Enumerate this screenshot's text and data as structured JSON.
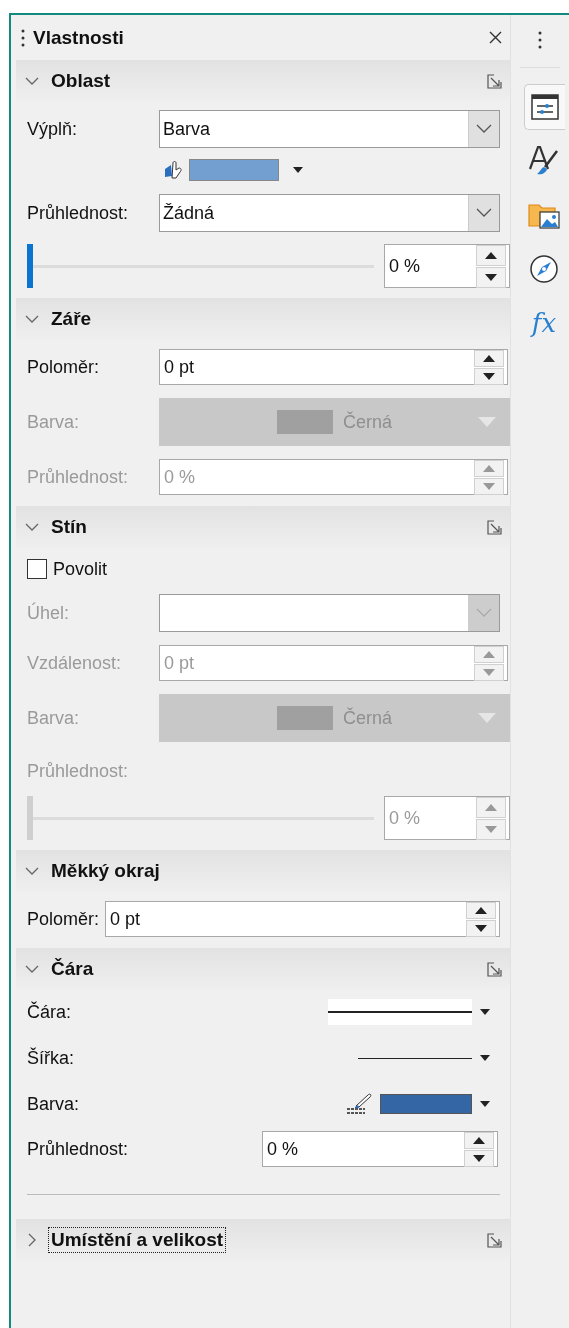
{
  "panel": {
    "title": "Vlastnosti"
  },
  "sections": [
    {
      "title": "Oblast",
      "expanded": true,
      "more_options": true,
      "focused": false,
      "rows": [
        {
          "kind": "dropdown",
          "label": "Výplň:",
          "value": "Barva",
          "disabled": false
        },
        {
          "kind": "color_picker",
          "color": "#729fcf"
        },
        {
          "kind": "dropdown",
          "label": "Průhlednost:",
          "value": "Žádná",
          "disabled": false
        },
        {
          "kind": "slider",
          "level": 0,
          "value": "0 %",
          "disabled": false
        }
      ]
    },
    {
      "title": "Záře",
      "expanded": true,
      "more_options": false,
      "focused": false,
      "rows": [
        {
          "kind": "spin",
          "label": "Poloměr:",
          "value": "0 pt",
          "disabled": false
        },
        {
          "kind": "color_button",
          "label": "Barva:",
          "value": "Černá",
          "disabled": true
        },
        {
          "kind": "spin",
          "label": "Průhlednost:",
          "value": "0 %",
          "disabled": true
        }
      ]
    },
    {
      "title": "Stín",
      "expanded": true,
      "more_options": true,
      "focused": false,
      "rows": [
        {
          "kind": "checkbox",
          "label": "Povolit",
          "checked": false
        },
        {
          "kind": "dropdown",
          "label": "Úhel:",
          "disabled": true
        },
        {
          "kind": "spin",
          "label": "Vzdálenost:",
          "value": "0 pt",
          "disabled": true
        },
        {
          "kind": "color_button",
          "label": "Barva:",
          "value": "Černá",
          "disabled": true
        },
        {
          "kind": "label",
          "label": "Průhlednost:",
          "disabled": true
        },
        {
          "kind": "slider",
          "level": 0,
          "value": "0 %",
          "disabled": true
        }
      ]
    },
    {
      "title": "Měkký okraj",
      "expanded": true,
      "more_options": false,
      "focused": false,
      "rows": [
        {
          "kind": "spin_inline",
          "label": "Poloměr:",
          "value": "0 pt",
          "disabled": false
        }
      ]
    },
    {
      "title": "Čára",
      "expanded": true,
      "more_options": true,
      "focused": false,
      "rows": [
        {
          "kind": "line_style",
          "label": "Čára:"
        },
        {
          "kind": "line_width",
          "label": "Šířka:"
        },
        {
          "kind": "line_color",
          "label": "Barva:",
          "color": "#3465a4"
        },
        {
          "kind": "spin_right",
          "label": "Průhlednost:",
          "value": "0 %",
          "disabled": false
        },
        {
          "kind": "separator"
        }
      ]
    },
    {
      "title": "Umístění a velikost",
      "expanded": false,
      "more_options": true,
      "focused": true
    }
  ],
  "tab_bar": {
    "tabs": [
      {
        "kind": "properties",
        "selected": true
      },
      {
        "kind": "styles",
        "selected": false
      },
      {
        "kind": "gallery",
        "selected": false
      },
      {
        "kind": "navigator",
        "selected": false
      },
      {
        "kind": "functions",
        "selected": false,
        "text": "fx"
      }
    ]
  }
}
